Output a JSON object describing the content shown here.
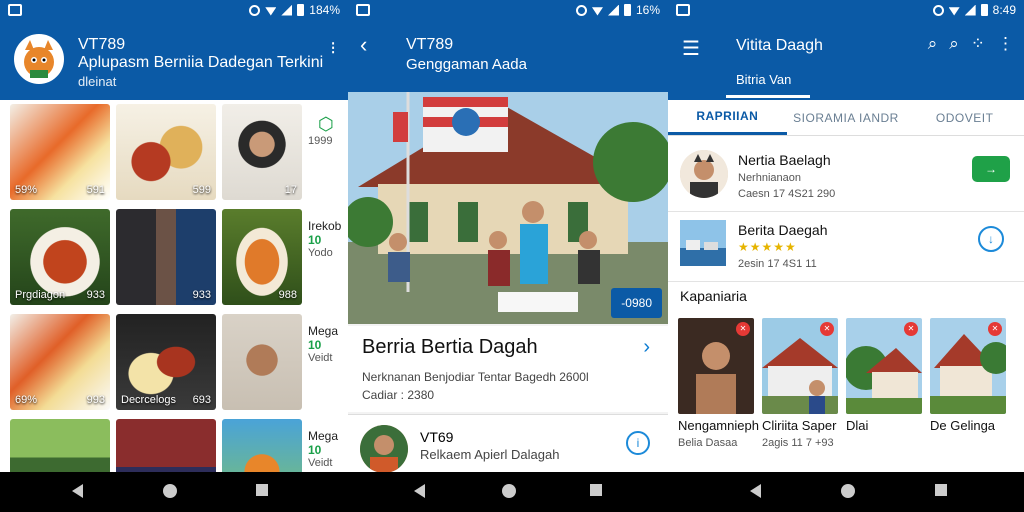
{
  "colors": {
    "brand_blue": "#0b5aa6",
    "accent_green": "#1fa148",
    "badge_red": "#e53935",
    "star_gold": "#e6b400"
  },
  "screen1": {
    "status": {
      "battery": "184%"
    },
    "appbar": {
      "title": "VT789",
      "subtitle": "Aplupasm Berniia Dadegan Terkini",
      "subtitle2": "dleinat"
    },
    "tiles": [
      {
        "label": "59%",
        "count": "591"
      },
      {
        "label": "",
        "count": "599"
      },
      {
        "label": "",
        "count": "17"
      },
      {
        "label": "Prgdiagon",
        "count": "933"
      },
      {
        "label": "",
        "count": "933"
      },
      {
        "label": "",
        "count": "988"
      },
      {
        "label": "69%",
        "count": "993"
      },
      {
        "label": "Decrcelogs",
        "count": "693"
      },
      {
        "label": "",
        "count": ""
      }
    ],
    "side": [
      {
        "line1": "",
        "line2": "1999",
        "line3": ""
      },
      {
        "line1": "Irekob",
        "line2": "10",
        "line3": "Yodo"
      },
      {
        "line1": "Mega",
        "line2": "10",
        "line3": "Veidt"
      },
      {
        "line1": "Mega",
        "line2": "10",
        "line3": "Veidt"
      }
    ]
  },
  "screen2": {
    "status": {
      "battery": "16%"
    },
    "appbar": {
      "title": "VT789",
      "subtitle": "Genggaman Aada"
    },
    "hero_badge": "-0980",
    "article": {
      "title": "Berria Bertia Dagah",
      "desc": "Nerknanan Benjodiar Tentar Bagedh 2600l",
      "meta": "Cadiar : 2380"
    },
    "comment": {
      "name": "VT69",
      "text": "Relkaem Apierl Dalagah"
    }
  },
  "screen3": {
    "status": {
      "time": "8:49"
    },
    "appbar": {
      "title": "Vitita Daagh",
      "subtab": "Bitria Van"
    },
    "tabs": [
      "RAPRIIAN",
      "SIORAMIA IANDR",
      "ODOVEIT"
    ],
    "items": [
      {
        "title": "Nertia Baelagh",
        "sub": "Nerhnianaon",
        "meta": "Caesn 17 4S21 290",
        "action": "→"
      },
      {
        "title": "Berita Daegah",
        "stars": "★★★★★",
        "meta": "2esin 17 4S1 11",
        "action": "↓"
      }
    ],
    "section_title": "Kapaniaria",
    "cards": [
      {
        "caption": "Nengamnieph",
        "sub": "Belia Dasaa"
      },
      {
        "caption": "Cliriita Saper",
        "sub": "2agis 11 7 +93"
      },
      {
        "caption": "Dlai",
        "sub": ""
      },
      {
        "caption": "De Gelinga",
        "sub": ""
      }
    ]
  }
}
